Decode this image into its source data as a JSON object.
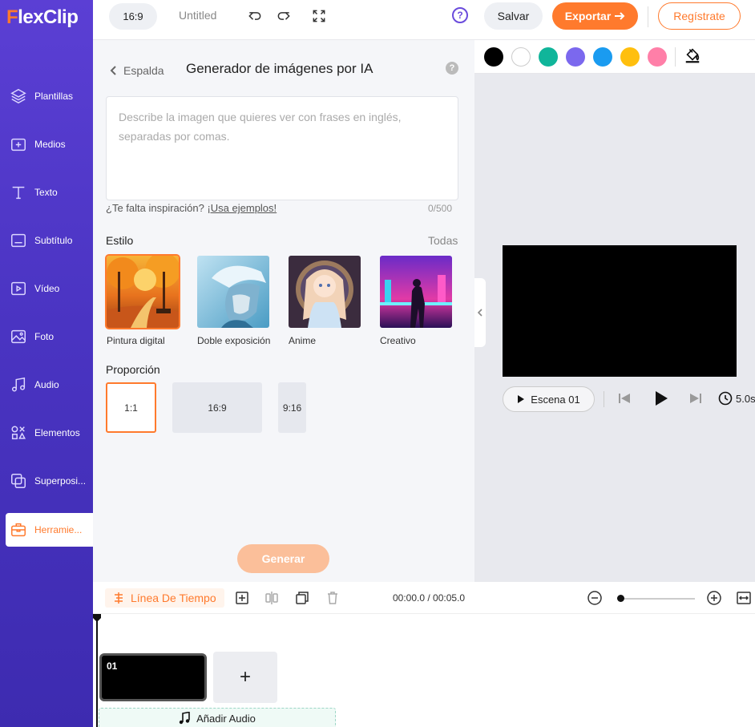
{
  "app": {
    "logo_text": "lexClip",
    "logo_f": "F"
  },
  "sidebar": {
    "items": [
      {
        "label": "Plantillas",
        "icon": "layers-icon"
      },
      {
        "label": "Medios",
        "icon": "folder-plus-icon"
      },
      {
        "label": "Texto",
        "icon": "text-icon"
      },
      {
        "label": "Subtítulo",
        "icon": "subtitle-icon"
      },
      {
        "label": "Vídeo",
        "icon": "video-icon"
      },
      {
        "label": "Foto",
        "icon": "photo-icon"
      },
      {
        "label": "Audio",
        "icon": "music-icon"
      },
      {
        "label": "Elementos",
        "icon": "elements-icon"
      },
      {
        "label": "Superposi...",
        "icon": "overlay-icon"
      },
      {
        "label": "Herramie...",
        "icon": "toolbox-icon",
        "active": true
      }
    ]
  },
  "topbar": {
    "aspect_ratio": "16:9",
    "document_title": "Untitled",
    "help": "?",
    "save_label": "Salvar",
    "export_label": "Exportar",
    "register_label": "Regístrate"
  },
  "panel": {
    "back_label": "Espalda",
    "title": "Generador de imágenes por IA",
    "help": "?",
    "prompt_placeholder": "Describe la imagen que quieres ver con frases en inglés, separadas por comas.",
    "prompt_value": "",
    "inspiration_text": "¿Te falta inspiración? ",
    "examples_link": "¡Usa ejemplos!",
    "char_counter": "0/500",
    "style_heading": "Estilo",
    "all_styles": "Todas",
    "styles": [
      {
        "label": "Pintura digital",
        "selected": true
      },
      {
        "label": "Doble exposición",
        "selected": false
      },
      {
        "label": "Anime",
        "selected": false
      },
      {
        "label": "Creativo",
        "selected": false
      }
    ],
    "ratio_heading": "Proporción",
    "ratios": [
      {
        "label": "1:1",
        "selected": true
      },
      {
        "label": "16:9",
        "selected": false
      },
      {
        "label": "9:16",
        "selected": false
      }
    ],
    "generate_label": "Generar"
  },
  "colors": {
    "accent": "#ff7a2d",
    "sidebar": "#4a34c2",
    "swatches": [
      "#000000",
      "#ffffff",
      "#10b59a",
      "#7b68ee",
      "#1a9bf0",
      "#ffbf0e",
      "#ff7fa8"
    ]
  },
  "preview": {
    "scene_label": "Escena  01",
    "duration": "5.0s"
  },
  "timeline": {
    "label": "Línea De Tiempo",
    "time": "00:00.0 / 00:05.0",
    "clip_label": "01",
    "add_clip": "+",
    "add_audio": "Añadir Audio"
  }
}
